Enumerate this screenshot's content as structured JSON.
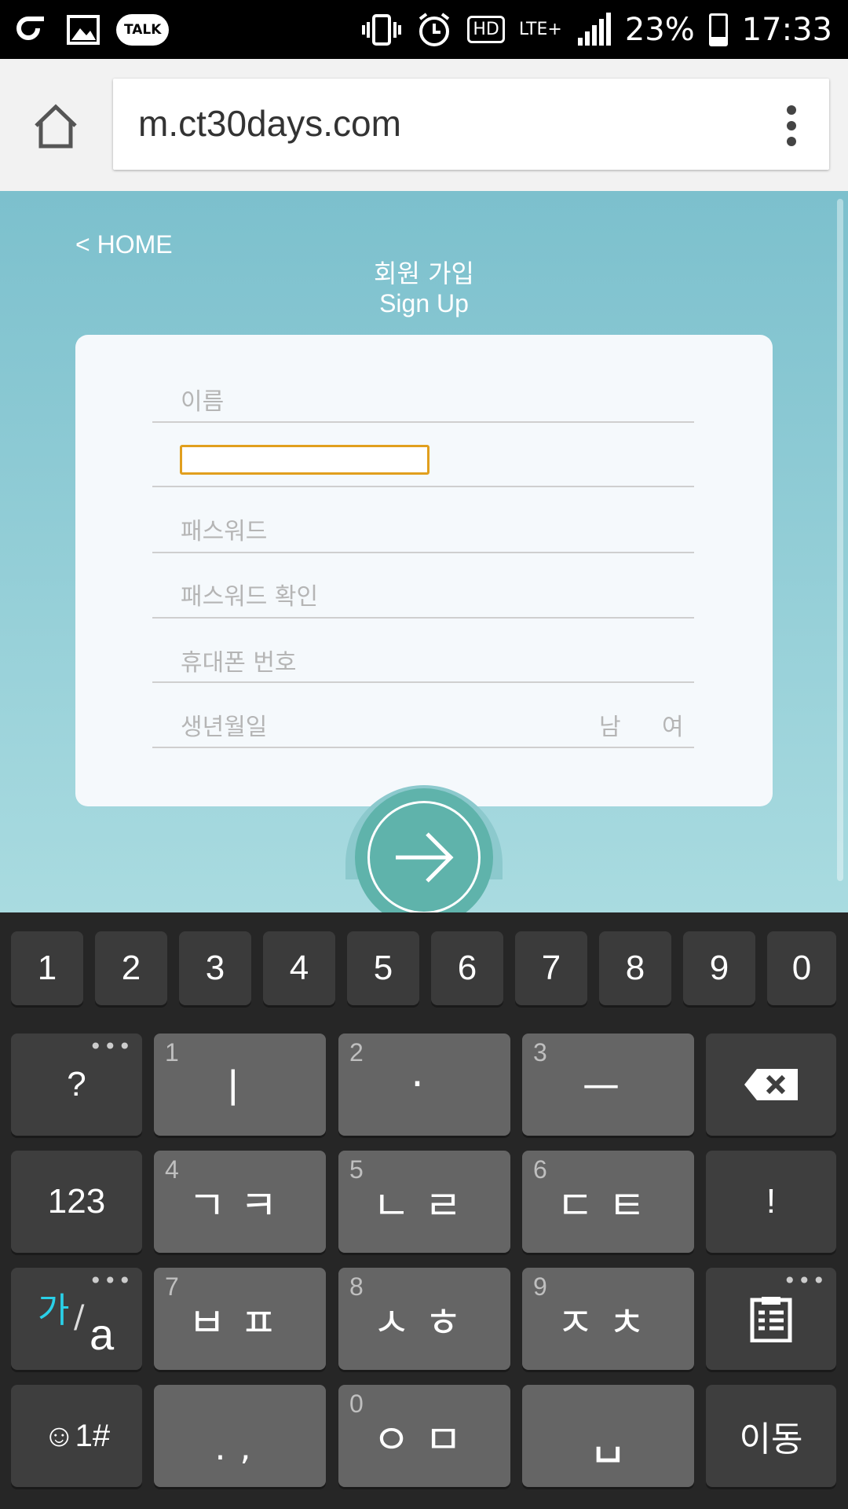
{
  "status": {
    "battery": "23%",
    "time": "17:33",
    "talk_label": "TALK",
    "hd_label": "HD",
    "lte_label": "LTE+"
  },
  "browser": {
    "url": "m.ct30days.com"
  },
  "page": {
    "back_label": "HOME",
    "title_ko": "회원 가입",
    "title_en": "Sign Up",
    "fields": {
      "name_placeholder": "이름",
      "password_placeholder": "패스워드",
      "password_confirm_placeholder": "패스워드 확인",
      "phone_placeholder": "휴대폰 번호",
      "birth_placeholder": "생년월일"
    },
    "gender": {
      "male": "남",
      "female": "여"
    }
  },
  "keyboard": {
    "numbers": [
      "1",
      "2",
      "3",
      "4",
      "5",
      "6",
      "7",
      "8",
      "9",
      "0"
    ],
    "row1": {
      "left": "?",
      "keys": [
        {
          "hint": "1",
          "label": "ㅣ"
        },
        {
          "hint": "2",
          "label": "·"
        },
        {
          "hint": "3",
          "label": "ㅡ"
        }
      ]
    },
    "row2": {
      "left": "123",
      "keys": [
        {
          "hint": "4",
          "label": "ㄱㅋ"
        },
        {
          "hint": "5",
          "label": "ㄴㄹ"
        },
        {
          "hint": "6",
          "label": "ㄷㅌ"
        }
      ],
      "right": "!"
    },
    "row3": {
      "lang_ko": "가",
      "lang_en": "a",
      "keys": [
        {
          "hint": "7",
          "label": "ㅂㅍ"
        },
        {
          "hint": "8",
          "label": "ㅅㅎ"
        },
        {
          "hint": "9",
          "label": "ㅈㅊ"
        }
      ]
    },
    "row4": {
      "emoji_label": "☺1#",
      "punct": ".,",
      "key_hint": "0",
      "key_label": "ㅇㅁ",
      "space": "␣",
      "enter": "이동"
    }
  }
}
